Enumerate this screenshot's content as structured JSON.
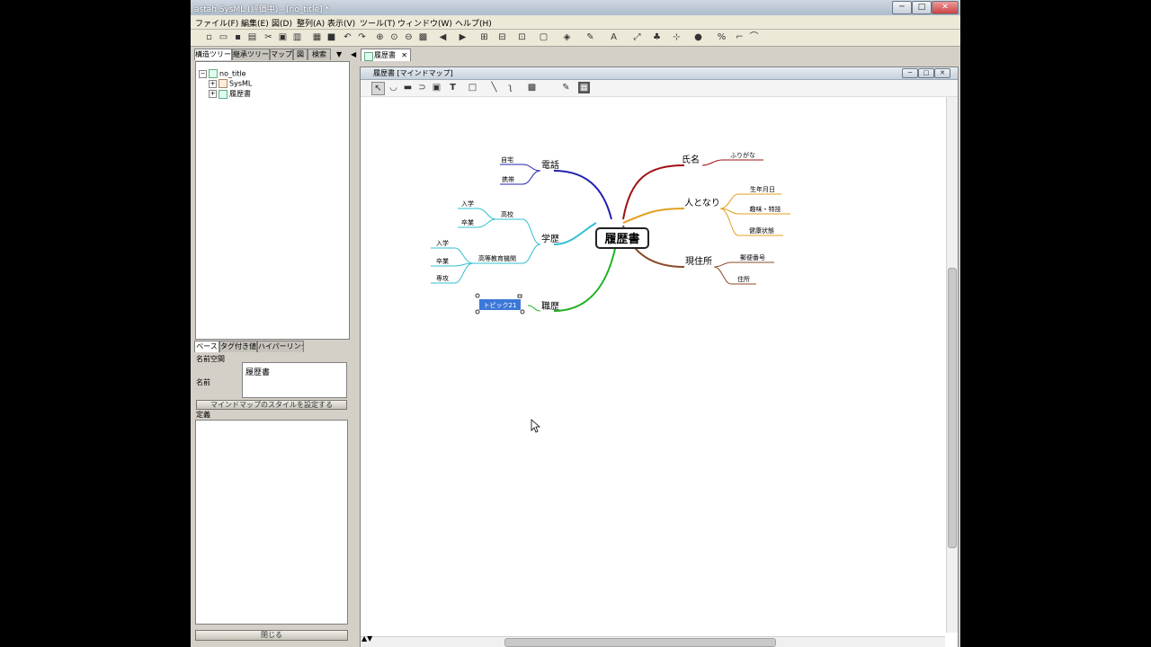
{
  "window": {
    "title": "astah SysML (評価中) - [no_title] *",
    "min_label": "─",
    "max_label": "□",
    "close_label": "✕"
  },
  "menu": [
    "ファイル(F)",
    "編集(E)",
    "図(D)",
    "整列(A)",
    "表示(V)",
    "ツール(T)",
    "ウィンドウ(W)",
    "ヘルプ(H)"
  ],
  "left_tabs": [
    "構造ツリー",
    "継承ツリー",
    "マップ",
    "図",
    "検索"
  ],
  "tree": {
    "root": "no_title",
    "items": [
      "SysML",
      "履歴書"
    ]
  },
  "props": {
    "tabs": [
      "ベース",
      "タグ付き値",
      "ハイパーリンク"
    ],
    "namespace_label": "名前空間",
    "name_label": "名前",
    "name_value": "履歴書",
    "style_button": "マインドマップのスタイルを設定する",
    "definition_label": "定義",
    "close_button": "閉じる"
  },
  "editor": {
    "tab_label": "履歴書",
    "tab_close": "✕",
    "diagram_title": "履歴書 [マインドマップ]"
  },
  "mindmap": {
    "root": "履歴書",
    "name": "氏名",
    "name_child": "ふりがな",
    "persona": "人となり",
    "persona_children": [
      "生年月日",
      "趣味・特技",
      "健康状態"
    ],
    "address": "現住所",
    "address_children": [
      "郵便番号",
      "住所"
    ],
    "phone": "電話",
    "phone_children": [
      "自宅",
      "携帯"
    ],
    "education": "学歴",
    "highschool": "高校",
    "highschool_children": [
      "入学",
      "卒業"
    ],
    "higher": "高等教育機関",
    "higher_children": [
      "入学",
      "卒業",
      "専攻"
    ],
    "career": "職歴",
    "career_child": "トピック21"
  },
  "colors": {
    "name_branch": "#a01010",
    "persona_branch": "#e0a020",
    "address_branch": "#8a4a2a",
    "phone_branch": "#2020b0",
    "education_branch": "#30c0d0",
    "career_branch": "#20b020",
    "selection": "#3c78d8"
  }
}
